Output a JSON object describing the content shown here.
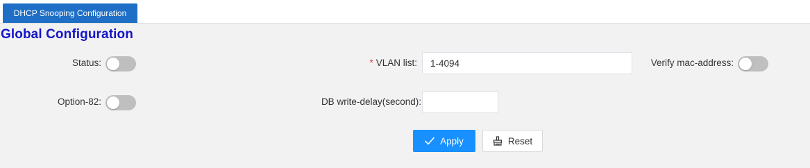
{
  "tabs": [
    {
      "label": "DHCP Snooping Configuration",
      "active": true
    }
  ],
  "section": {
    "title": "Global Configuration"
  },
  "form": {
    "status": {
      "label": "Status:",
      "enabled": false
    },
    "option82": {
      "label": "Option-82:",
      "enabled": false
    },
    "vlan_list": {
      "required_mark": "*",
      "label": "VLAN list:",
      "value": "1-4094"
    },
    "db_write_delay": {
      "label": "DB write-delay(second):",
      "value": ""
    },
    "verify_mac": {
      "label": "Verify mac-address:",
      "enabled": false
    }
  },
  "actions": {
    "apply": {
      "label": "Apply",
      "icon": "check-icon"
    },
    "reset": {
      "label": "Reset",
      "icon": "broom-icon"
    }
  },
  "colors": {
    "tab_active": "#1f6fc6",
    "title": "#1414c8",
    "primary": "#1890ff",
    "switch_off": "#bfbfbf",
    "required": "#e03c3c",
    "panel_bg": "#f2f2f2"
  }
}
